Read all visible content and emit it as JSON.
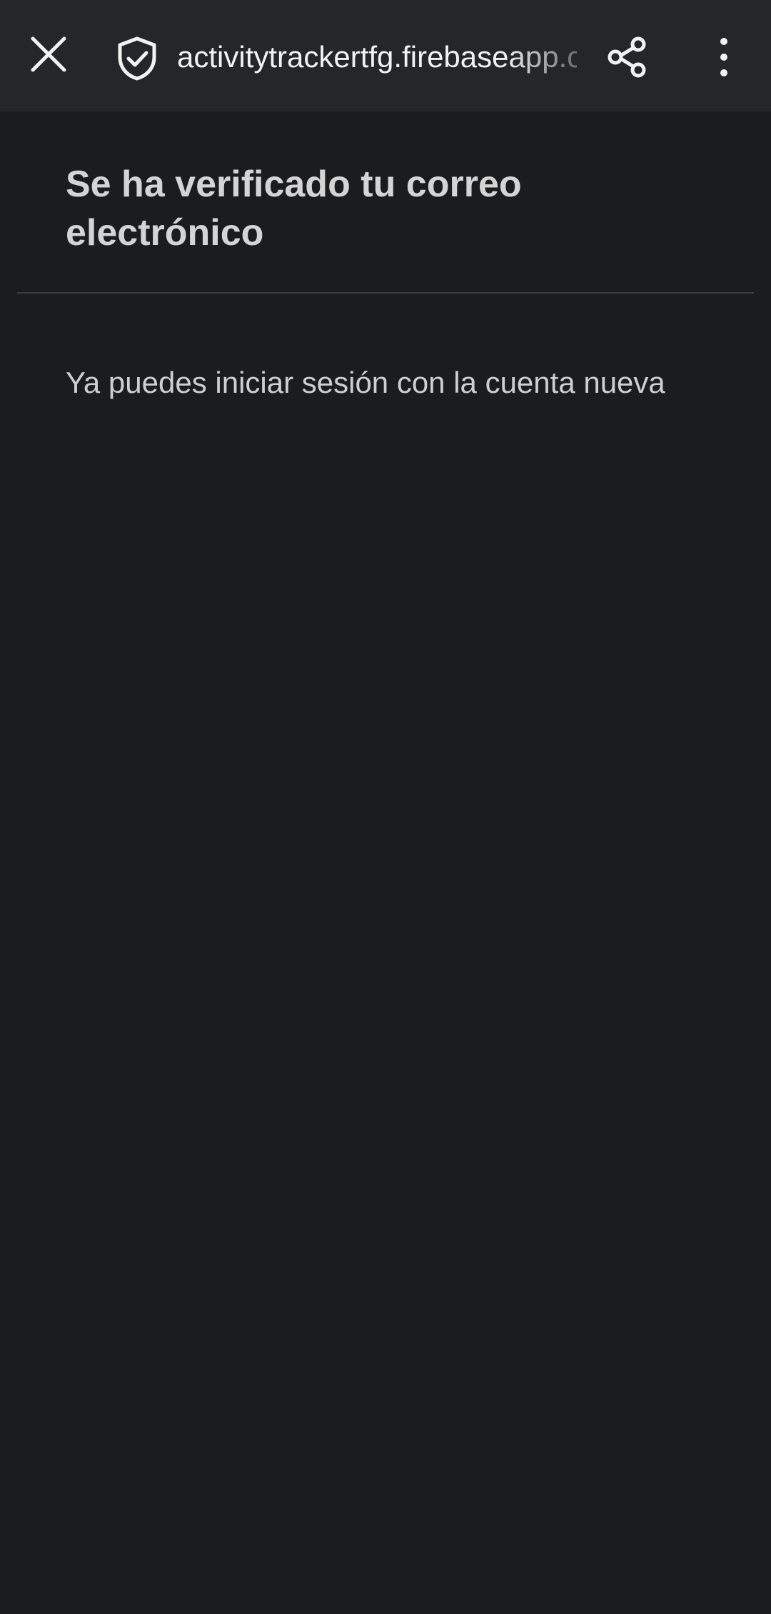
{
  "browser": {
    "url": "activitytrackertfg.firebaseapp.com",
    "icons": {
      "close": "close-icon",
      "security": "shield-check-icon",
      "share": "share-icon",
      "menu": "more-vert-icon"
    }
  },
  "page": {
    "title": "Se ha verificado tu correo electrónico",
    "message": "Ya puedes iniciar sesión con la cuenta nueva"
  },
  "colors": {
    "toolbar": "#24262a",
    "background": "#1b1c1e"
  }
}
